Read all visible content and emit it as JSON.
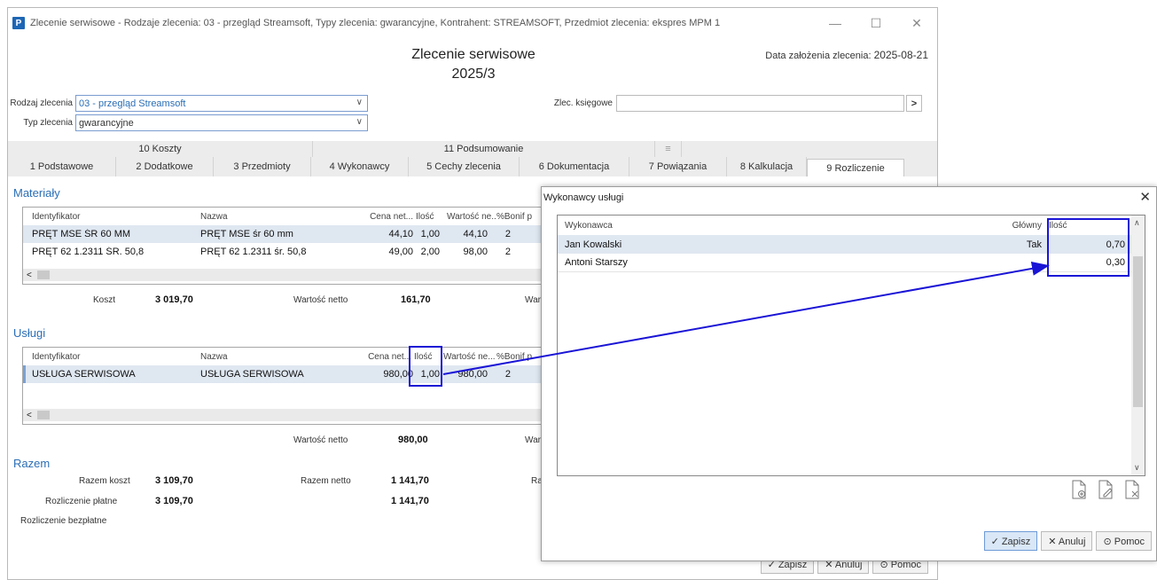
{
  "window": {
    "title": "Zlecenie serwisowe - Rodzaje zlecenia: 03 - przegląd Streamsoft, Typy zlecenia: gwarancyjne, Kontrahent: STREAMSOFT, Przedmiot zlecenia: ekspres MPM 1",
    "app_icon": "P",
    "minimize": "—",
    "maximize": "☐",
    "close": "✕"
  },
  "header": {
    "title": "Zlecenie serwisowe",
    "number": "2025/3",
    "date_label": "Data założenia zlecenia:",
    "date_value": "2025-08-21"
  },
  "form": {
    "rodzaj_label": "Rodzaj zlecenia",
    "rodzaj_value": "03 - przegląd Streamsoft",
    "typ_label": "Typ zlecenia",
    "typ_value": "gwarancyjne",
    "zlec_label": "Zlec. księgowe",
    "zlec_value": "",
    "zlec_btn": ">"
  },
  "tabs_top": [
    "10 Koszty",
    "11 Podsumowanie",
    "≡"
  ],
  "tabs_bottom": [
    "1 Podstawowe",
    "2 Dodatkowe",
    "3 Przedmioty",
    "4 Wykonawcy",
    "5 Cechy zlecenia",
    "6 Dokumentacja",
    "7 Powiązania",
    "8 Kalkulacja",
    "9 Rozliczenie"
  ],
  "materialy": {
    "title": "Materiały",
    "headers": [
      "Identyfikator",
      "Nazwa",
      "Cena net...",
      "Ilość",
      "Wartość ne...",
      "%Bonif p"
    ],
    "rows": [
      [
        "PRĘT MSE ŚR 60 MM",
        "PRĘT MSE śr 60 mm",
        "44,10",
        "1,00",
        "44,10",
        "2"
      ],
      [
        "PRĘT 62 1.2311 ŚR. 50,8",
        "PRĘT 62 1.2311 śr. 50,8",
        "49,00",
        "2,00",
        "98,00",
        "2"
      ]
    ],
    "koszt_label": "Koszt",
    "koszt_value": "3 019,70",
    "wartosc_label": "Wartość netto",
    "wartosc_value": "161,70",
    "wart_trunc": "Wart"
  },
  "uslugi": {
    "title": "Usługi",
    "headers": [
      "Identyfikator",
      "Nazwa",
      "Cena net...",
      "Ilość",
      "Wartość ne...",
      "%Bonif p"
    ],
    "rows": [
      [
        "USŁUGA SERWISOWA",
        "USŁUGA SERWISOWA",
        "980,00",
        "1,00",
        "980,00",
        "2"
      ]
    ],
    "wartosc_label": "Wartość netto",
    "wartosc_value": "980,00",
    "wart_trunc": "Wart"
  },
  "razem": {
    "title": "Razem",
    "razem_koszt_label": "Razem koszt",
    "razem_koszt_value": "3 109,70",
    "razem_netto_label": "Razem netto",
    "razem_netto_value": "1 141,70",
    "ra_trunc": "Ra",
    "platne_label": "Rozliczenie płatne",
    "platne_value": "3 109,70",
    "platne_netto": "1 141,70",
    "bezplatne_label": "Rozliczenie bezpłatne"
  },
  "main_buttons": {
    "zapisz": "✓ Zapisz",
    "anuluj": "✕ Anuluj",
    "pomoc": "⊙ Pomoc"
  },
  "dialog": {
    "title": "Wykonawcy usługi",
    "close": "✕",
    "headers": [
      "Wykonawca",
      "Główny",
      "Ilość"
    ],
    "rows": [
      [
        "Jan Kowalski",
        "Tak",
        "0,70"
      ],
      [
        "Antoni Starszy",
        "",
        "0,30"
      ]
    ],
    "zapisz": "✓ Zapisz",
    "anuluj": "✕ Anuluj",
    "pomoc": "⊙ Pomoc"
  },
  "colors": {
    "accent": "#2a6eb6",
    "highlight": "#1a14d6",
    "selected_row": "#dfe7f1"
  }
}
